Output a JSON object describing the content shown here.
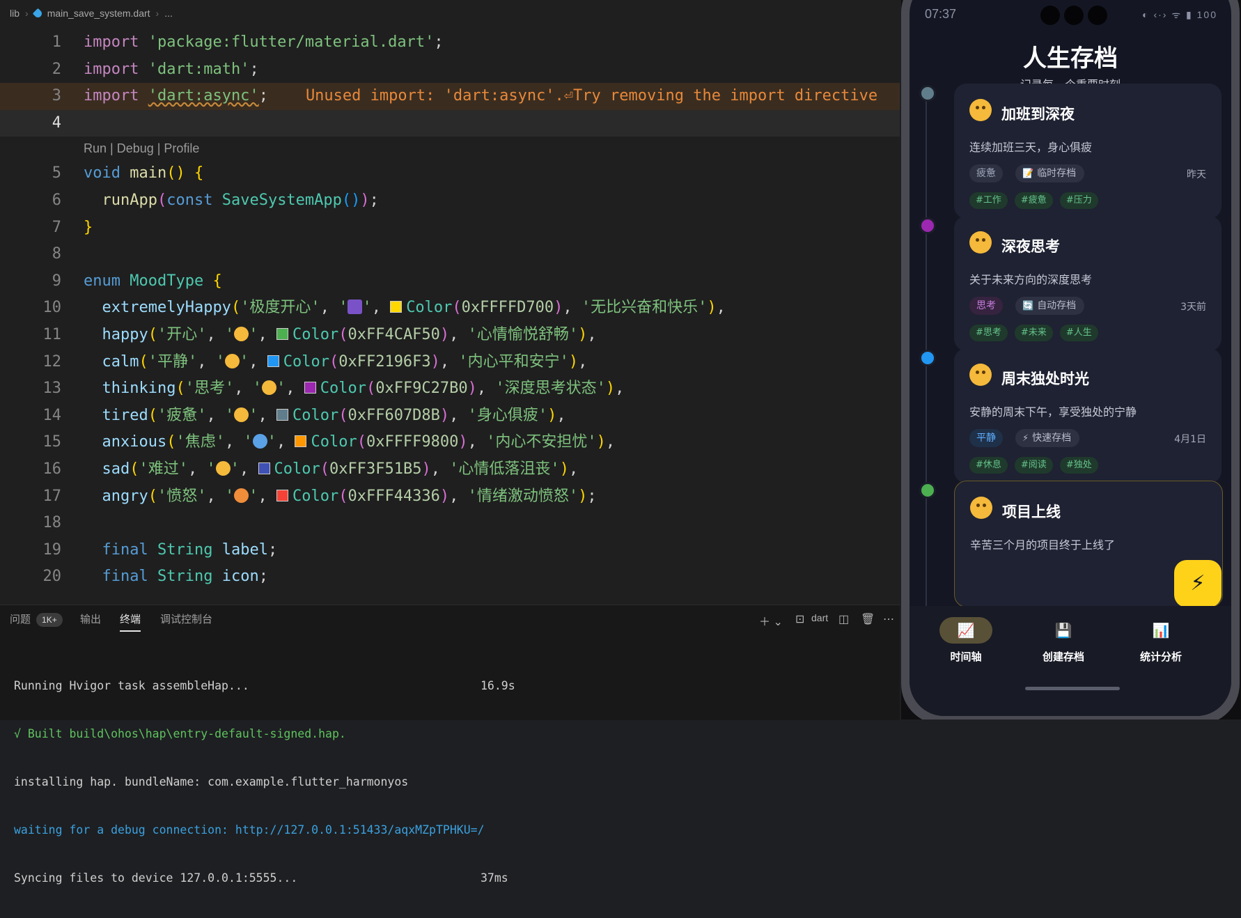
{
  "breadcrumb": {
    "root": "lib",
    "file": "main_save_system.dart",
    "more": "..."
  },
  "editor": {
    "lines": {
      "l1": {
        "kw": "import",
        "str": "'package:flutter/material.dart'",
        "end": ";"
      },
      "l2": {
        "kw": "import",
        "str": "'dart:math'",
        "end": ";"
      },
      "l3": {
        "kw": "import",
        "str": "'dart:async'",
        "end": ";",
        "warning": "Unused import: 'dart:async'.⏎Try removing the import directive"
      },
      "codelens": "Run | Debug | Profile",
      "l5": {
        "kw": "void",
        "fn": "main",
        "rest": "() {"
      },
      "l6": {
        "fn": "runApp",
        "kw": "const",
        "ty": "SaveSystemApp"
      },
      "l7": "}",
      "l9": {
        "kw": "enum",
        "ty": "MoodType",
        "rest": "{"
      },
      "l19": {
        "kw": "final",
        "ty": "String",
        "name": "label"
      },
      "l20": {
        "kw": "final",
        "ty": "String",
        "name": "icon"
      },
      "moods": [
        {
          "name": "extremelyHappy",
          "cn": "'极度开心'",
          "color": "0xFFFFD700",
          "desc": "'无比兴奋和快乐'",
          "swatch": "#FFD700",
          "end": "),"
        },
        {
          "name": "happy",
          "cn": "'开心'",
          "color": "0xFF4CAF50",
          "desc": "'心情愉悦舒畅'",
          "swatch": "#4CAF50",
          "end": "),"
        },
        {
          "name": "calm",
          "cn": "'平静'",
          "color": "0xFF2196F3",
          "desc": "'内心平和安宁'",
          "swatch": "#2196F3",
          "end": "),"
        },
        {
          "name": "thinking",
          "cn": "'思考'",
          "color": "0xFF9C27B0",
          "desc": "'深度思考状态'",
          "swatch": "#9C27B0",
          "end": "),"
        },
        {
          "name": "tired",
          "cn": "'疲惫'",
          "color": "0xFF607D8B",
          "desc": "'身心俱疲'",
          "swatch": "#607D8B",
          "end": "),"
        },
        {
          "name": "anxious",
          "cn": "'焦虑'",
          "color": "0xFFFF9800",
          "desc": "'内心不安担忧'",
          "swatch": "#FF9800",
          "end": "),"
        },
        {
          "name": "sad",
          "cn": "'难过'",
          "color": "0xFF3F51B5",
          "desc": "'心情低落沮丧'",
          "swatch": "#3F51B5",
          "end": "),"
        },
        {
          "name": "angry",
          "cn": "'愤怒'",
          "color": "0xFFF44336",
          "desc": "'情绪激动愤怒'",
          "swatch": "#F44336",
          "end": ");"
        }
      ]
    }
  },
  "panel": {
    "tabs": {
      "problems": "问题",
      "problems_count": "1K+",
      "output": "输出",
      "terminal": "终端",
      "debug_console": "调试控制台"
    },
    "shell": "dart",
    "terminal": {
      "l1": "Running Hvigor task assembleHap...",
      "l1_time": "16.9s",
      "l2": "√ Built build\\ohos\\hap\\entry-default-signed.hap.",
      "l3": "installing hap. bundleName: com.example.flutter_harmonyos",
      "l4": "waiting for a debug connection: http://127.0.0.1:51433/aqxMZpTPHKU=/",
      "l5": "Syncing files to device 127.0.0.1:5555...",
      "l5_time": "37ms"
    }
  },
  "phone": {
    "status_time": "07:37",
    "status_right": "◐ ‹·› ᯤ ▮ 100",
    "title": "人生存档",
    "subtitle": "记录每一个重要时刻",
    "cards": [
      {
        "title": "加班到深夜",
        "desc": "连续加班三天，身心俱疲",
        "mood": "疲惫",
        "save_type": "临时存档",
        "save_icon": "📝",
        "when": "昨天",
        "tags": [
          "#工作",
          "#疲惫",
          "#压力"
        ],
        "dot": "#607D8B",
        "mood_bg": "#2d3142",
        "mood_fg": "#9aa3b5"
      },
      {
        "title": "深夜思考",
        "desc": "关于未来方向的深度思考",
        "mood": "思考",
        "save_type": "自动存档",
        "save_icon": "🔄",
        "when": "3天前",
        "tags": [
          "#思考",
          "#未来",
          "#人生"
        ],
        "dot": "#9C27B0",
        "mood_bg": "#35233f",
        "mood_fg": "#c77ddb"
      },
      {
        "title": "周末独处时光",
        "desc": "安静的周末下午，享受独处的宁静",
        "mood": "平静",
        "save_type": "快速存档",
        "save_icon": "⚡",
        "when": "4月1日",
        "tags": [
          "#休息",
          "#阅读",
          "#独处"
        ],
        "dot": "#2196F3",
        "mood_bg": "#1f3049",
        "mood_fg": "#5fb0ff"
      },
      {
        "title": "项目上线",
        "desc": "辛苦三个月的项目终于上线了",
        "dot": "#4CAF50"
      }
    ],
    "fab_icon": "⚡",
    "nav": [
      {
        "label": "时间轴",
        "icon": "📈"
      },
      {
        "label": "创建存档",
        "icon": "💾"
      },
      {
        "label": "统计分析",
        "icon": "📊"
      }
    ]
  }
}
